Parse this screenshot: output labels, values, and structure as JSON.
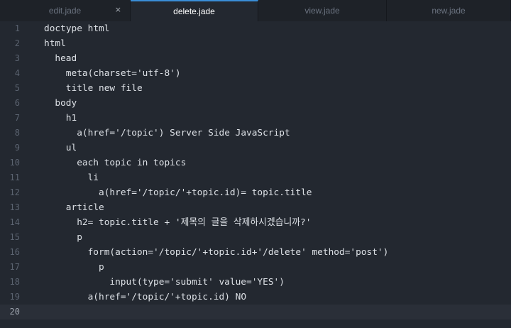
{
  "tabs": [
    {
      "label": "edit.jade",
      "active": false,
      "closable": true
    },
    {
      "label": "delete.jade",
      "active": true,
      "closable": false
    },
    {
      "label": "view.jade",
      "active": false,
      "closable": false
    },
    {
      "label": "new.jade",
      "active": false,
      "closable": false
    }
  ],
  "tab_close_glyph": "×",
  "editor": {
    "current_line": 20,
    "lines": [
      {
        "num": "1",
        "indent": 0,
        "text": "doctype html"
      },
      {
        "num": "2",
        "indent": 0,
        "text": "html"
      },
      {
        "num": "3",
        "indent": 1,
        "text": "head"
      },
      {
        "num": "4",
        "indent": 2,
        "text": "meta(charset='utf-8')"
      },
      {
        "num": "5",
        "indent": 2,
        "text": "title new file"
      },
      {
        "num": "6",
        "indent": 1,
        "text": "body"
      },
      {
        "num": "7",
        "indent": 2,
        "text": "h1"
      },
      {
        "num": "8",
        "indent": 3,
        "text": "a(href='/topic') Server Side JavaScript"
      },
      {
        "num": "9",
        "indent": 2,
        "text": "ul"
      },
      {
        "num": "10",
        "indent": 3,
        "text": "each topic in topics"
      },
      {
        "num": "11",
        "indent": 4,
        "text": "li"
      },
      {
        "num": "12",
        "indent": 5,
        "text": "a(href='/topic/'+topic.id)= topic.title"
      },
      {
        "num": "13",
        "indent": 2,
        "text": "article"
      },
      {
        "num": "14",
        "indent": 3,
        "text": "h2= topic.title + '제목의 글을 삭제하시겠습니까?'"
      },
      {
        "num": "15",
        "indent": 3,
        "text": "p"
      },
      {
        "num": "16",
        "indent": 4,
        "text": "form(action='/topic/'+topic.id+'/delete' method='post')"
      },
      {
        "num": "17",
        "indent": 5,
        "text": "p"
      },
      {
        "num": "18",
        "indent": 6,
        "text": "input(type='submit' value='YES')"
      },
      {
        "num": "19",
        "indent": 4,
        "text": "a(href='/topic/'+topic.id) NO"
      },
      {
        "num": "20",
        "indent": 0,
        "text": ""
      }
    ]
  },
  "colors": {
    "background": "#232830",
    "tab_inactive": "#1e2228",
    "tab_active_border": "#3a8dd6",
    "text": "#dde1e6",
    "line_number": "#5b6370",
    "current_line": "#2a2f38"
  }
}
